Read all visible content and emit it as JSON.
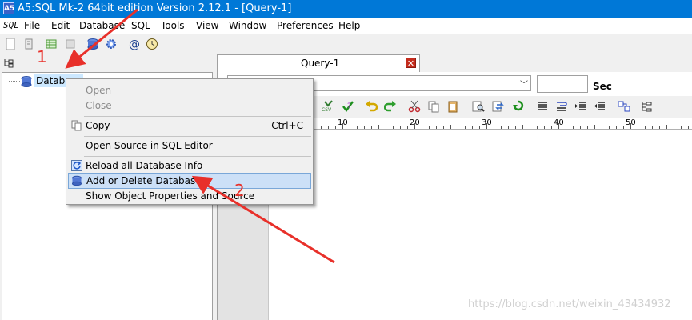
{
  "window": {
    "title": "A5:SQL Mk-2 64bit edition Version 2.12.1 - [Query-1]",
    "app_icon_text": "A5"
  },
  "menubar": {
    "sql_icon": "SQL",
    "items": [
      "File",
      "Edit",
      "Database",
      "SQL",
      "Tools",
      "View",
      "Window",
      "Preferences",
      "Help"
    ]
  },
  "tree": {
    "root_label": "Database"
  },
  "tabs": {
    "query_tab": "Query-1"
  },
  "editor": {
    "sec_label": "Sec",
    "ruler_ticks": [
      "10",
      "20",
      "30",
      "40",
      "50"
    ]
  },
  "context_menu": {
    "items": [
      {
        "label": "Open",
        "shortcut": "",
        "enabled": false
      },
      {
        "label": "Close",
        "shortcut": "",
        "enabled": false
      },
      {
        "label": "Copy",
        "shortcut": "Ctrl+C",
        "enabled": true
      },
      {
        "label": "Open Source in SQL Editor",
        "shortcut": "",
        "enabled": true
      },
      {
        "label": "Reload all Database Info",
        "shortcut": "",
        "enabled": true
      },
      {
        "label": "Add or Delete Database...",
        "shortcut": "",
        "enabled": true,
        "highlighted": true
      },
      {
        "label": "Show Object Properties and Source",
        "shortcut": "",
        "enabled": true
      }
    ]
  },
  "annotations": {
    "step1": "1",
    "step2": "2",
    "color": "#e8302a"
  },
  "watermark": "https://blog.csdn.net/weixin_43434932",
  "colors": {
    "titlebar": "#0078d7",
    "highlight": "#cce0f7"
  }
}
